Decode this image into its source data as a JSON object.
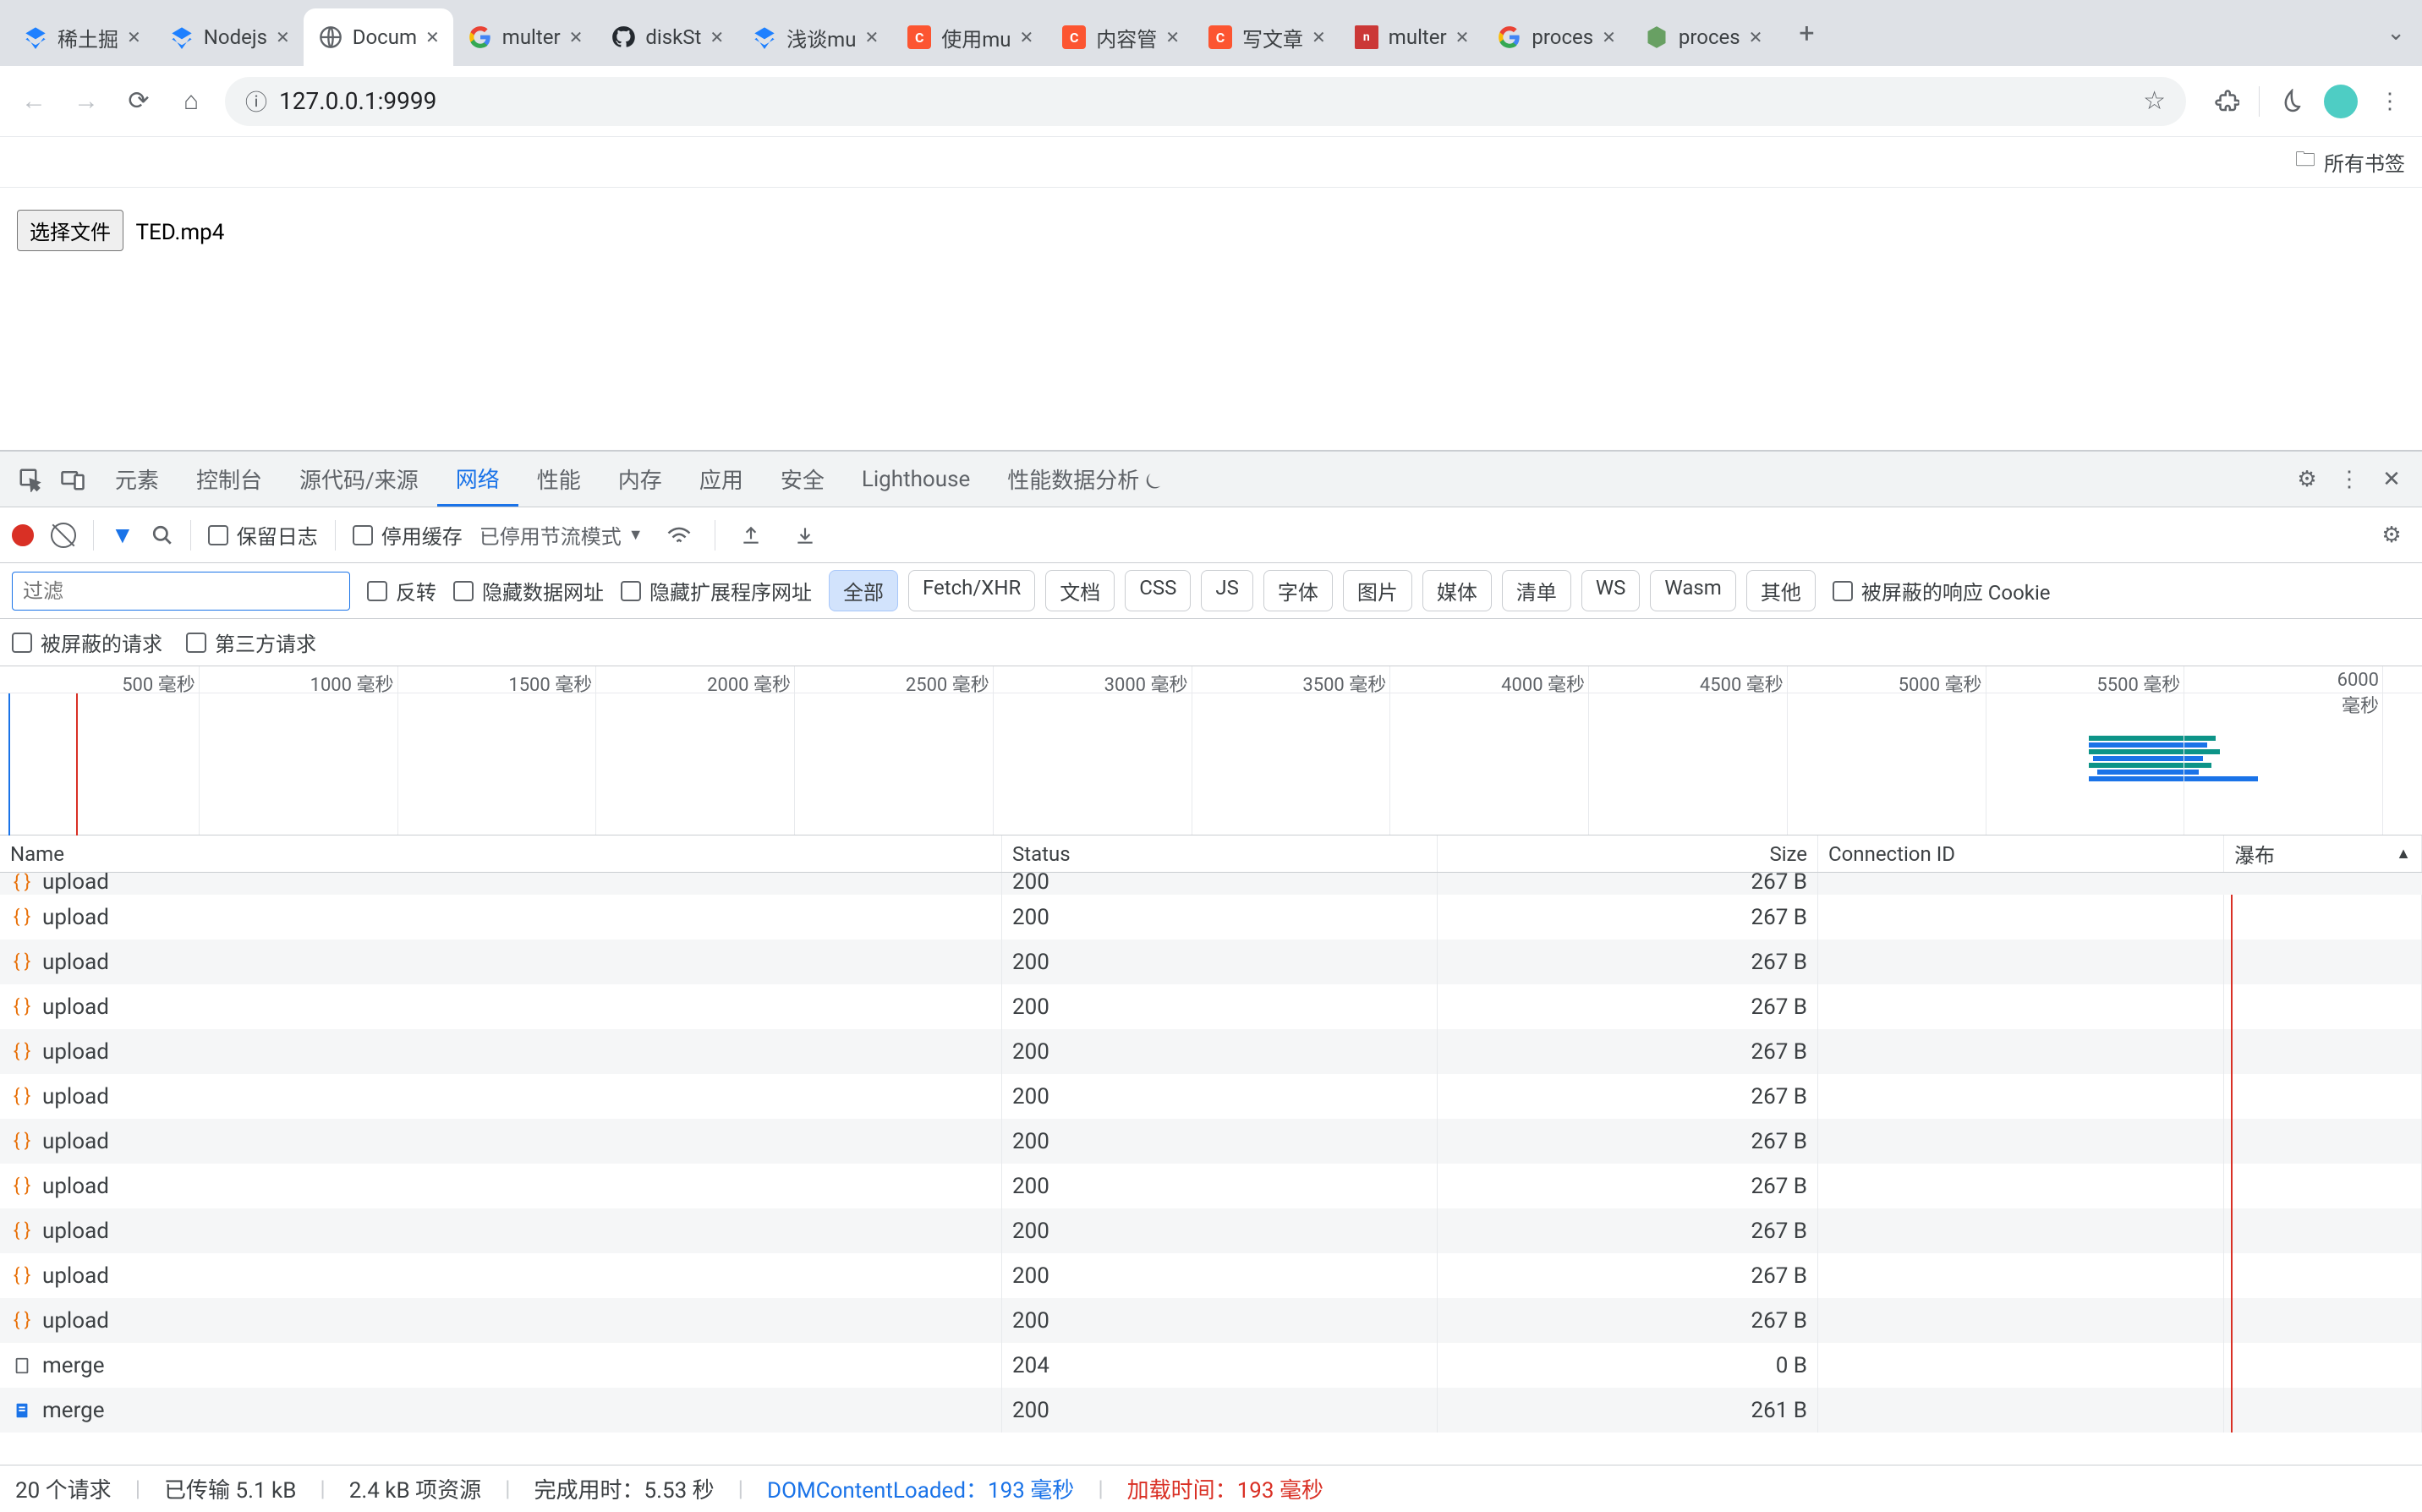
{
  "tabs": [
    {
      "icon": "juejin",
      "label": "稀土掘"
    },
    {
      "icon": "juejin",
      "label": "Nodejs"
    },
    {
      "icon": "globe",
      "label": "Docum",
      "active": true
    },
    {
      "icon": "google",
      "label": "multer"
    },
    {
      "icon": "github",
      "label": "diskSt"
    },
    {
      "icon": "juejin",
      "label": "浅谈mu"
    },
    {
      "icon": "csdn",
      "label": "使用mu"
    },
    {
      "icon": "csdn",
      "label": "内容管"
    },
    {
      "icon": "csdn",
      "label": "写文章"
    },
    {
      "icon": "npm",
      "label": "multer"
    },
    {
      "icon": "google",
      "label": "proces"
    },
    {
      "icon": "nodejs",
      "label": "proces"
    }
  ],
  "url": "127.0.0.1:9999",
  "bookmark_all": "所有书签",
  "page": {
    "file_btn": "选择文件",
    "file_name": "TED.mp4"
  },
  "dt": {
    "panels": [
      "元素",
      "控制台",
      "源代码/来源",
      "网络",
      "性能",
      "内存",
      "应用",
      "安全",
      "Lighthouse",
      "性能数据分析 ⏾"
    ],
    "active_panel": "网络",
    "preserve_log": "保留日志",
    "disable_cache": "停用缓存",
    "throttle": "已停用节流模式",
    "filter_placeholder": "过滤",
    "invert": "反转",
    "hide_data": "隐藏数据网址",
    "hide_ext": "隐藏扩展程序网址",
    "filter_chips": [
      "全部",
      "Fetch/XHR",
      "文档",
      "CSS",
      "JS",
      "字体",
      "图片",
      "媒体",
      "清单",
      "WS",
      "Wasm",
      "其他"
    ],
    "blocked_cookie": "被屏蔽的响应 Cookie",
    "blocked_req": "被屏蔽的请求",
    "third_party": "第三方请求",
    "timeline_ticks": [
      "500 毫秒",
      "1000 毫秒",
      "1500 毫秒",
      "2000 毫秒",
      "2500 毫秒",
      "3000 毫秒",
      "3500 毫秒",
      "4000 毫秒",
      "4500 毫秒",
      "5000 毫秒",
      "5500 毫秒",
      "6000 毫秒"
    ],
    "cols": {
      "name": "Name",
      "status": "Status",
      "size": "Size",
      "conn": "Connection ID",
      "wf": "瀑布"
    },
    "rows": [
      {
        "i": "fetch",
        "name": "upload",
        "status": "200",
        "size": "267 B"
      },
      {
        "i": "fetch",
        "name": "upload",
        "status": "200",
        "size": "267 B"
      },
      {
        "i": "fetch",
        "name": "upload",
        "status": "200",
        "size": "267 B"
      },
      {
        "i": "fetch",
        "name": "upload",
        "status": "200",
        "size": "267 B"
      },
      {
        "i": "fetch",
        "name": "upload",
        "status": "200",
        "size": "267 B"
      },
      {
        "i": "fetch",
        "name": "upload",
        "status": "200",
        "size": "267 B"
      },
      {
        "i": "fetch",
        "name": "upload",
        "status": "200",
        "size": "267 B"
      },
      {
        "i": "fetch",
        "name": "upload",
        "status": "200",
        "size": "267 B"
      },
      {
        "i": "fetch",
        "name": "upload",
        "status": "200",
        "size": "267 B"
      },
      {
        "i": "fetch",
        "name": "upload",
        "status": "200",
        "size": "267 B"
      },
      {
        "i": "fetch",
        "name": "upload",
        "status": "200",
        "size": "267 B"
      },
      {
        "i": "doc",
        "name": "merge",
        "status": "204",
        "size": "0 B"
      },
      {
        "i": "doc2",
        "name": "merge",
        "status": "200",
        "size": "261 B"
      }
    ],
    "status": {
      "req": "20 个请求",
      "xfer": "已传输 5.1 kB",
      "res": "2.4 kB 项资源",
      "finish": "完成用时：5.53 秒",
      "dcl_label": "DOMContentLoaded：",
      "dcl_val": "193 毫秒",
      "load_label": "加载时间：",
      "load_val": "193 毫秒"
    }
  }
}
